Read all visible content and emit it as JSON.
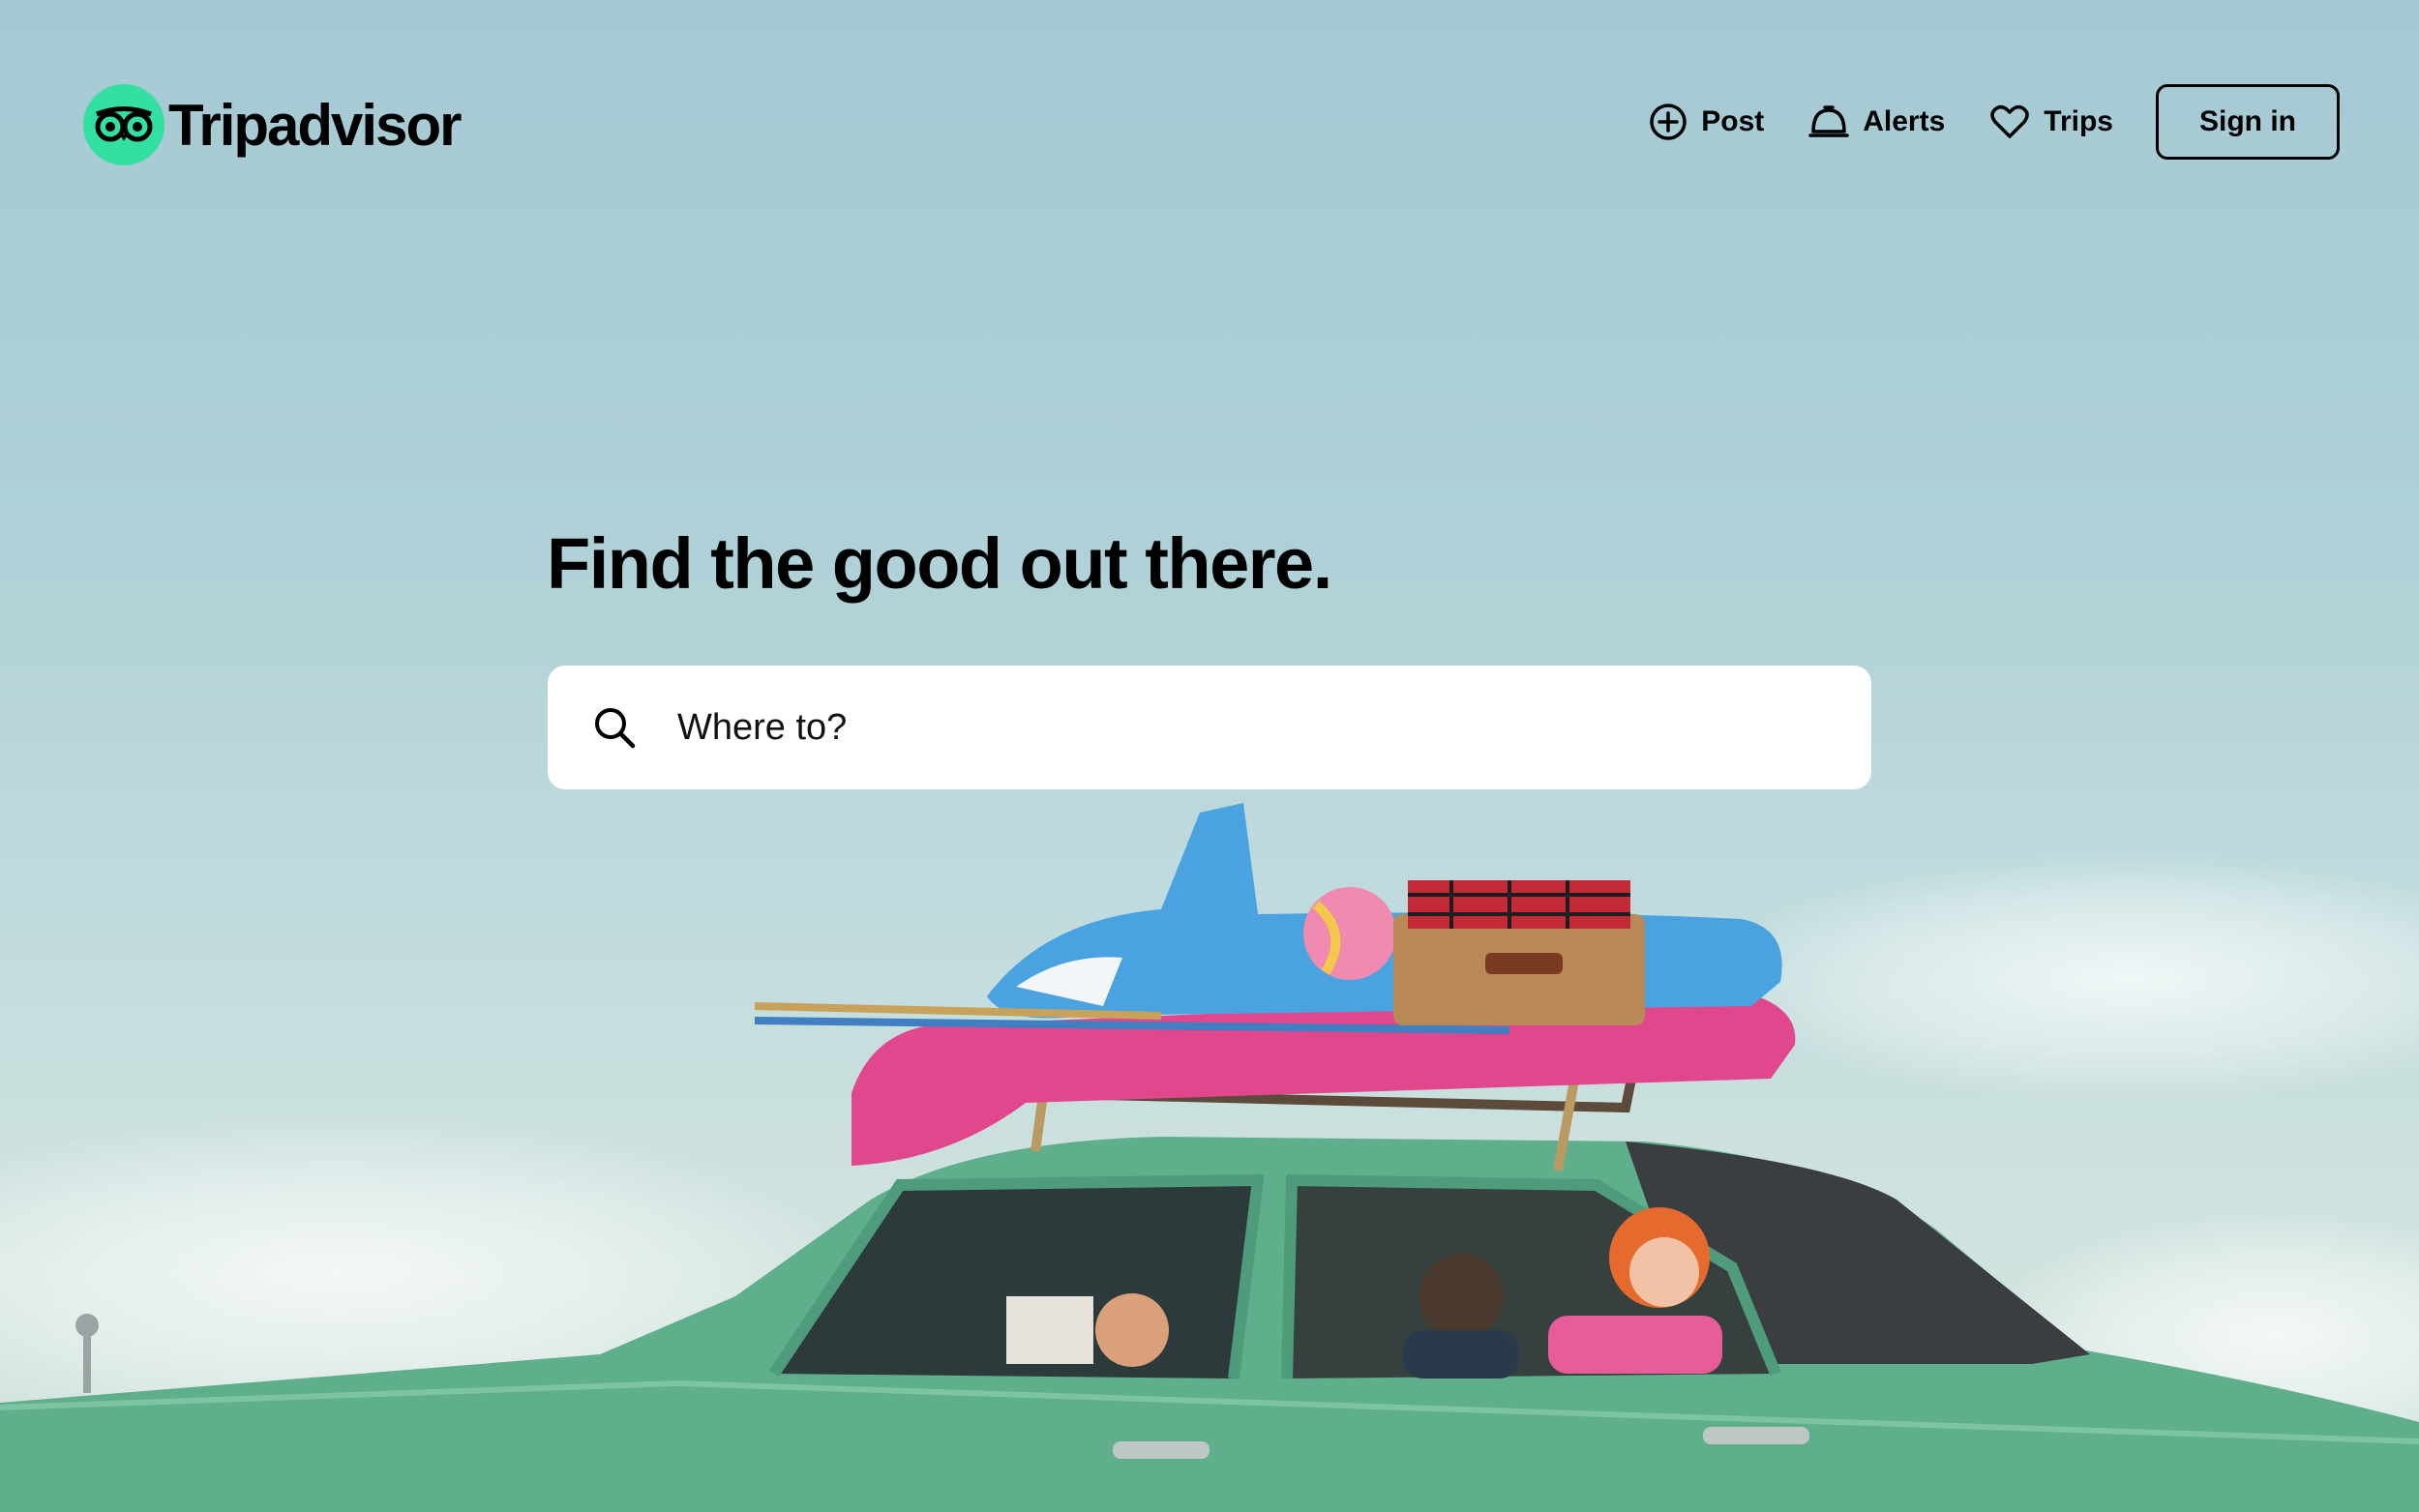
{
  "brand": {
    "name": "Tripadvisor",
    "accent": "#34e0a1"
  },
  "nav": {
    "items": [
      {
        "label": "Post",
        "icon": "plus-circle-icon"
      },
      {
        "label": "Alerts",
        "icon": "bell-icon"
      },
      {
        "label": "Trips",
        "icon": "heart-icon"
      }
    ],
    "signin_label": "Sign in"
  },
  "hero": {
    "headline": "Find the good out there.",
    "search_placeholder": "Where to?",
    "search_icon": "search-icon",
    "background": "photo of a green vintage car with inflatables and a picnic basket on its roof rack, family inside, against a pale blue sky"
  },
  "colors": {
    "sky_top": "#a5c9d3",
    "car_green": "#5fae8c",
    "text": "#000000"
  }
}
